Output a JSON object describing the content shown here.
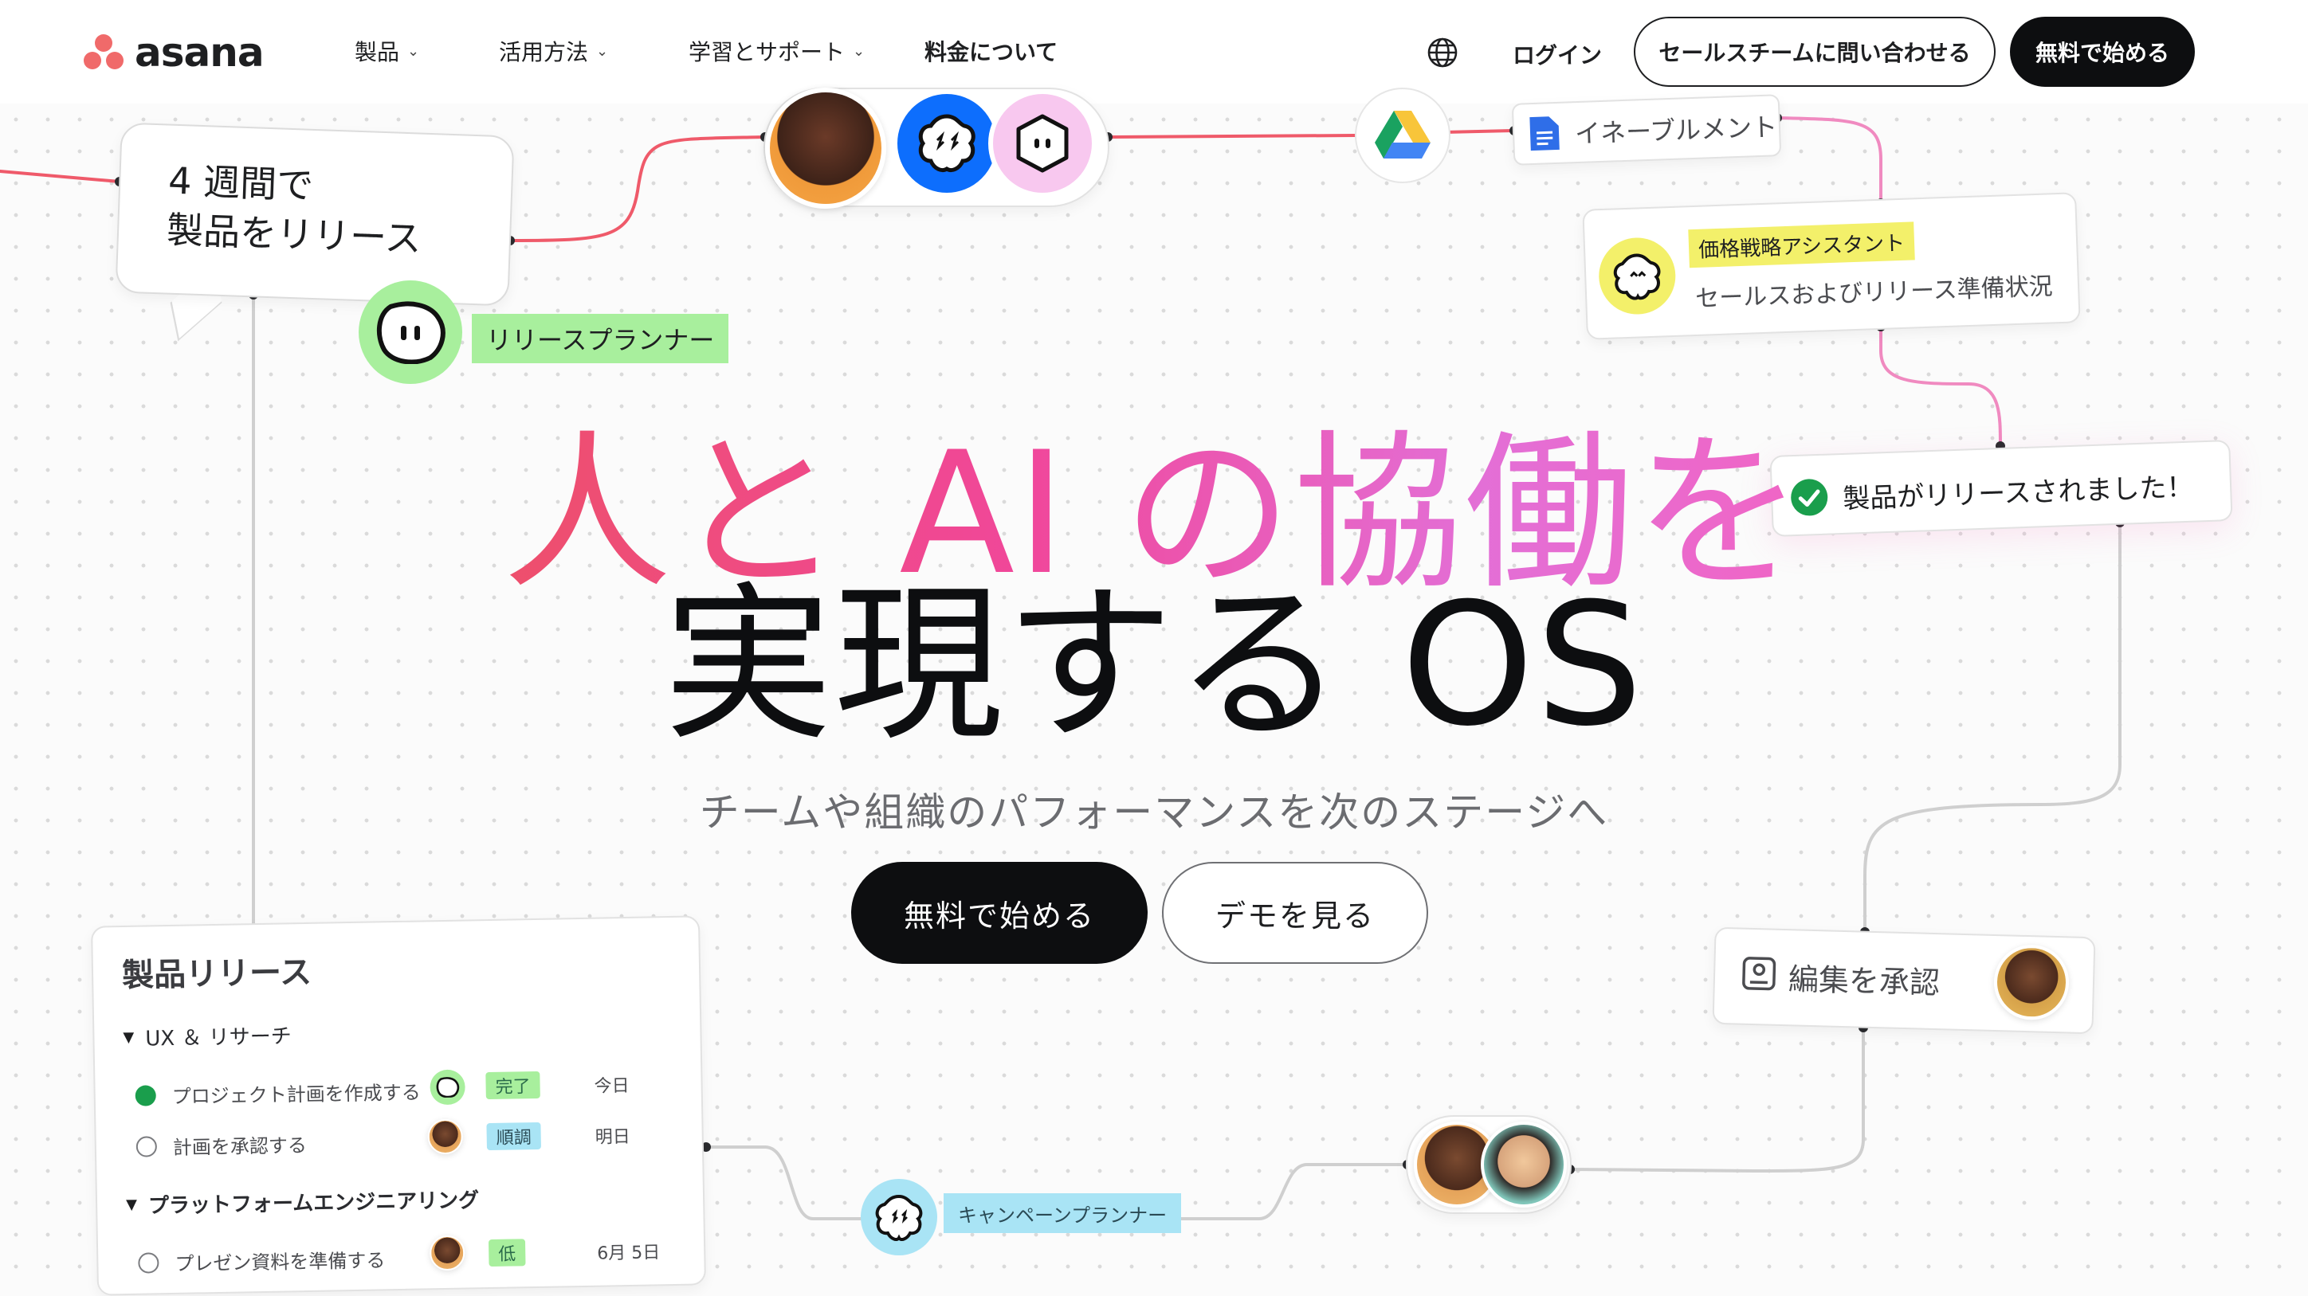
{
  "header": {
    "logo_text": "asana",
    "nav": [
      {
        "label": "製品",
        "has_menu": true
      },
      {
        "label": "活用方法",
        "has_menu": true
      },
      {
        "label": "学習とサポート",
        "has_menu": true
      },
      {
        "label": "料金について",
        "has_menu": false
      }
    ],
    "globe_icon": "globe-icon",
    "login": "ログイン",
    "contact_sales": "セールスチームに問い合わせる",
    "start_free": "無料で始める"
  },
  "hero": {
    "line1_gradient": "人と AI の協働を",
    "line2": "実現する OS",
    "subtitle": "チームや組織のパフォーマンスを次のステージへ",
    "cta_primary": "無料で始める",
    "cta_secondary": "デモを見る"
  },
  "canvas": {
    "bubble_line1": "4 週間で",
    "bubble_line2": "製品をリリース",
    "release_planner": "リリースプランナー",
    "enablement": "イネーブルメント",
    "pricing_assistant_tag": "価格戦略アシスタント",
    "pricing_assistant_text": "セールスおよびリリース準備状況",
    "product_released": "製品がリリースされました！",
    "approve_edit": "編集を承認",
    "campaign_planner": "キャンペーンプランナー"
  },
  "project_card": {
    "title": "製品リリース",
    "sections": [
      {
        "name": "UX ＆ リサーチ",
        "tasks": [
          {
            "name": "プロジェクト計画を作成する",
            "status": "完了",
            "due": "今日",
            "done": true
          },
          {
            "name": "計画を承認する",
            "status": "順調",
            "due": "明日",
            "done": false
          }
        ]
      },
      {
        "name": "プラットフォームエンジニアリング",
        "tasks": [
          {
            "name": "プレゼン資料を準備する",
            "status": "低",
            "due": "6月 5日",
            "done": false
          }
        ]
      }
    ]
  },
  "colors": {
    "brand_coral": "#f06a6a",
    "wire_coral": "#ef5a6a",
    "wire_pink": "#f08ac0",
    "wire_gray": "#cfcfcf",
    "release_green": "#a8ef9d",
    "pricing_yellow": "#f3f06a",
    "campaign_blue": "#a9e4f5"
  }
}
